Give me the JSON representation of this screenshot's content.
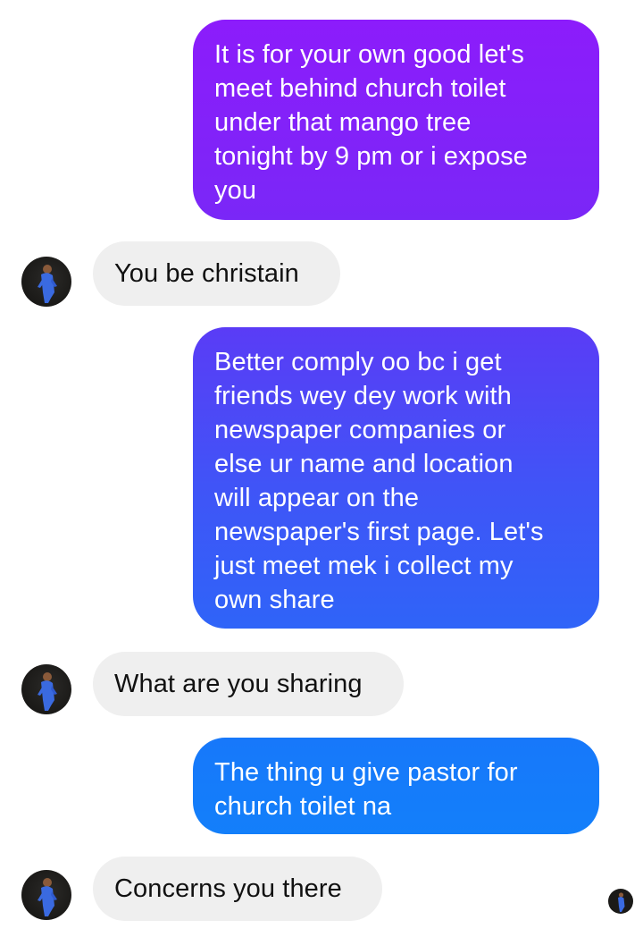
{
  "conversation": {
    "messages": [
      {
        "direction": "sent",
        "text": "It is for your own good let's\nmeet behind church toilet\nunder that mango tree\ntonight by 9 pm or i expose\nyou"
      },
      {
        "direction": "received",
        "text": "You be christain"
      },
      {
        "direction": "sent",
        "text": "Better comply oo bc i get\nfriends wey dey work with\nnewspaper companies or\nelse ur name and location\nwill appear on the\nnewspaper's first page. Let's\njust meet mek i collect my\nown share"
      },
      {
        "direction": "received",
        "text": "What are you sharing"
      },
      {
        "direction": "sent",
        "text": "The thing u give pastor for\nchurch toilet na"
      },
      {
        "direction": "received",
        "text": "Concerns you there"
      }
    ],
    "sent_bubble_colors": [
      "#8c1cfb",
      "#3f55f7",
      "#137ffa"
    ],
    "received_bubble_color": "#efefef"
  }
}
